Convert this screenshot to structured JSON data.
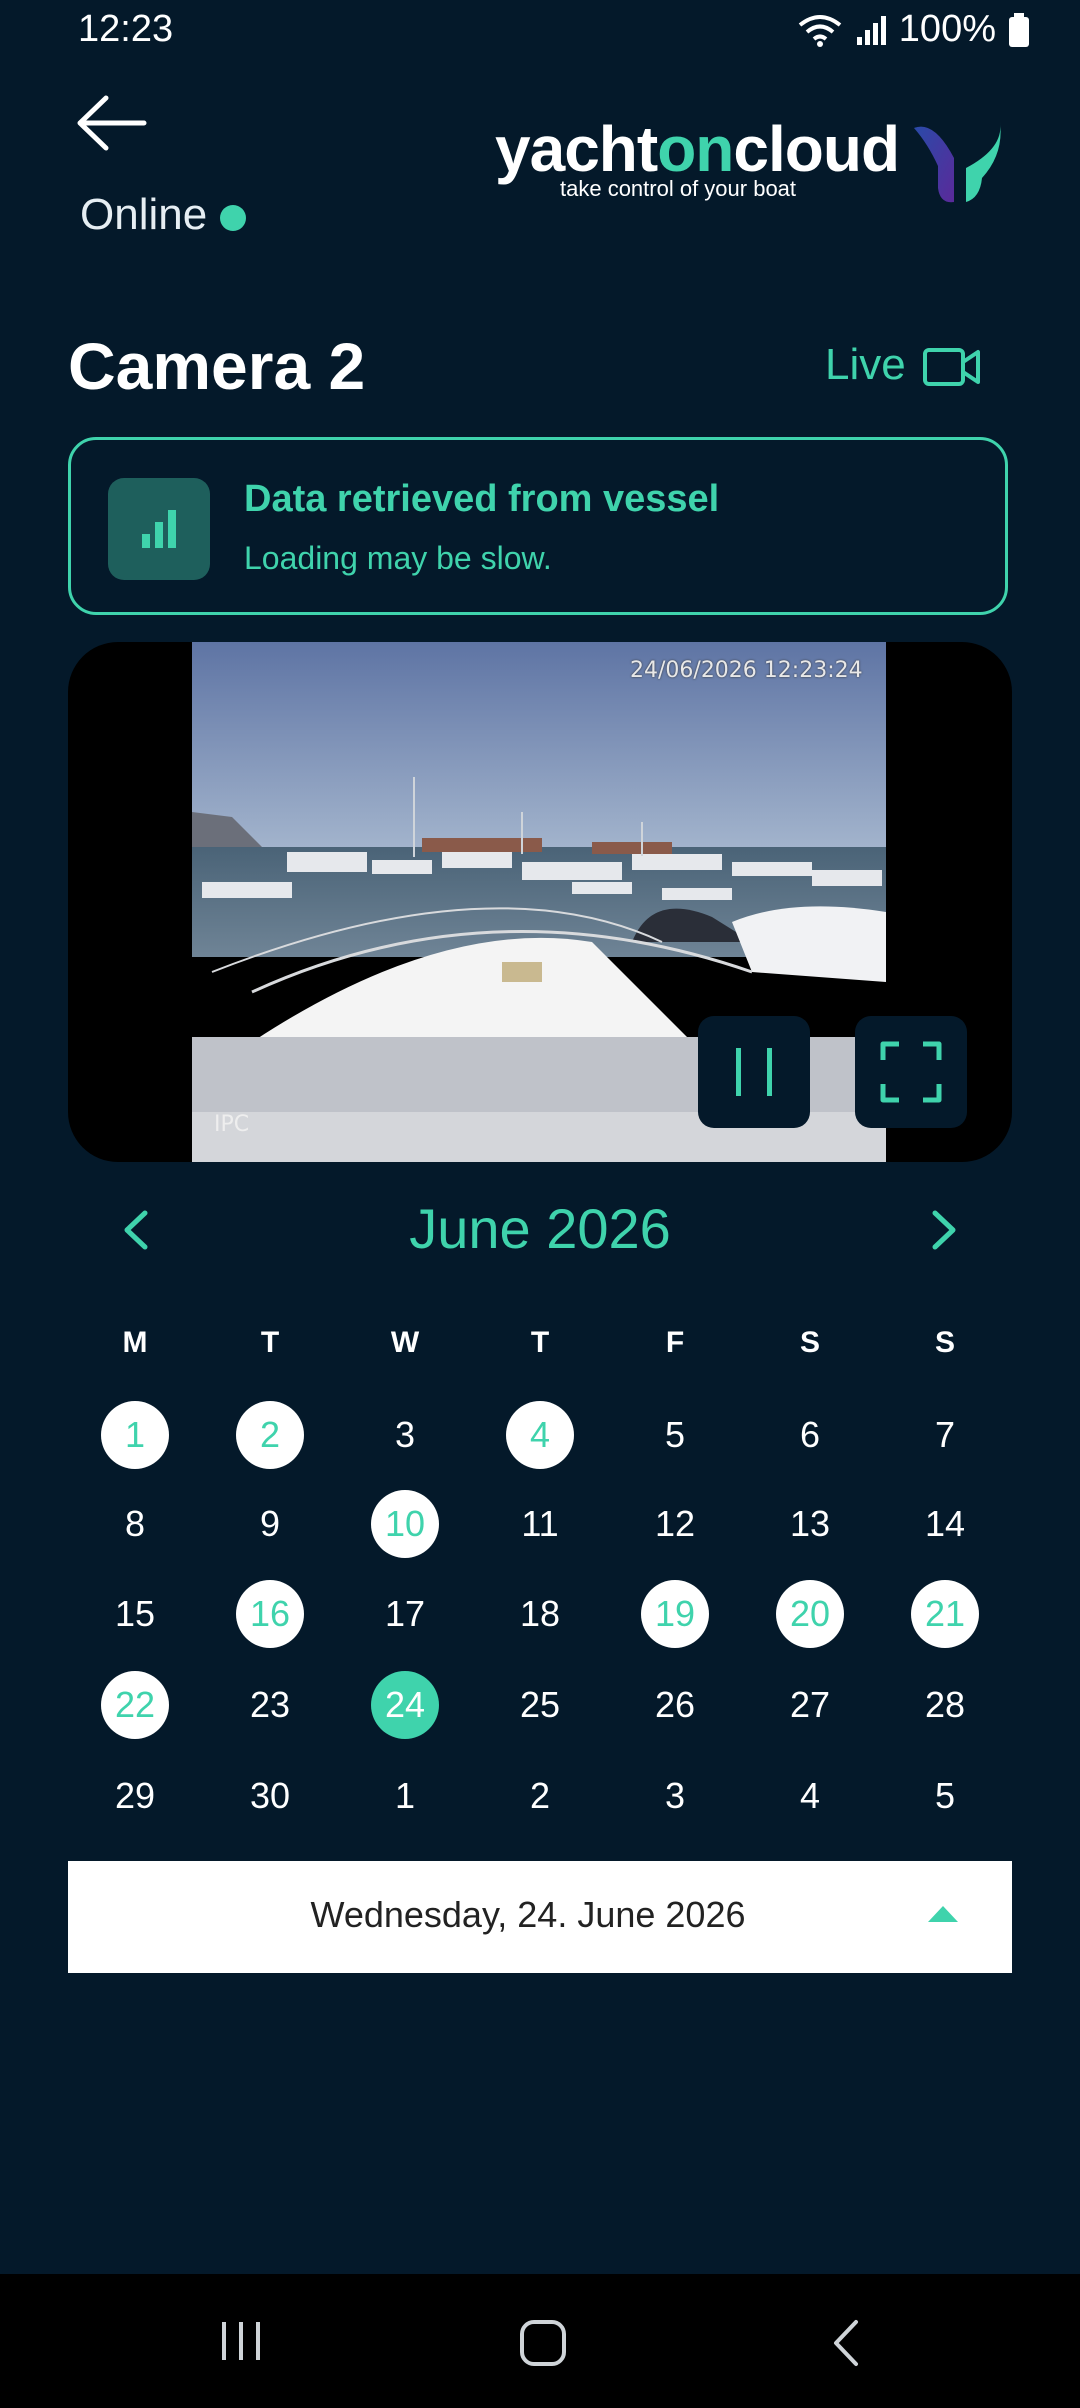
{
  "status_bar": {
    "time": "12:23",
    "battery": "100%"
  },
  "header": {
    "back_icon": "arrow-left-icon",
    "online_label": "Online",
    "online_color": "#3fd3ac",
    "logo": {
      "part1": "yacht",
      "part2": "on",
      "part3": "cloud",
      "tagline": "take control of your boat"
    }
  },
  "camera": {
    "title": "Camera 2",
    "live_label": "Live",
    "live_icon": "video-camera-icon"
  },
  "notice": {
    "title": "Data retrieved from vessel",
    "subtitle": "Loading may be slow.",
    "icon": "signal-bars-icon"
  },
  "video": {
    "timestamp": "24/06/2026 12:23:24",
    "watermark": "IPC",
    "pause_icon": "pause-icon",
    "fullscreen_icon": "fullscreen-icon"
  },
  "calendar": {
    "month_label": "June 2026",
    "weekdays": [
      "M",
      "T",
      "W",
      "T",
      "F",
      "S",
      "S"
    ],
    "weeks": [
      [
        "1",
        "2",
        "3",
        "4",
        "5",
        "6",
        "7"
      ],
      [
        "8",
        "9",
        "10",
        "11",
        "12",
        "13",
        "14"
      ],
      [
        "15",
        "16",
        "17",
        "18",
        "19",
        "20",
        "21"
      ],
      [
        "22",
        "23",
        "24",
        "25",
        "26",
        "27",
        "28"
      ],
      [
        "29",
        "30",
        "1",
        "2",
        "3",
        "4",
        "5"
      ]
    ],
    "selected_date": "Wednesday, 24. June 2026"
  },
  "colors": {
    "accent": "#3fd3ac",
    "background": "#04192a"
  }
}
